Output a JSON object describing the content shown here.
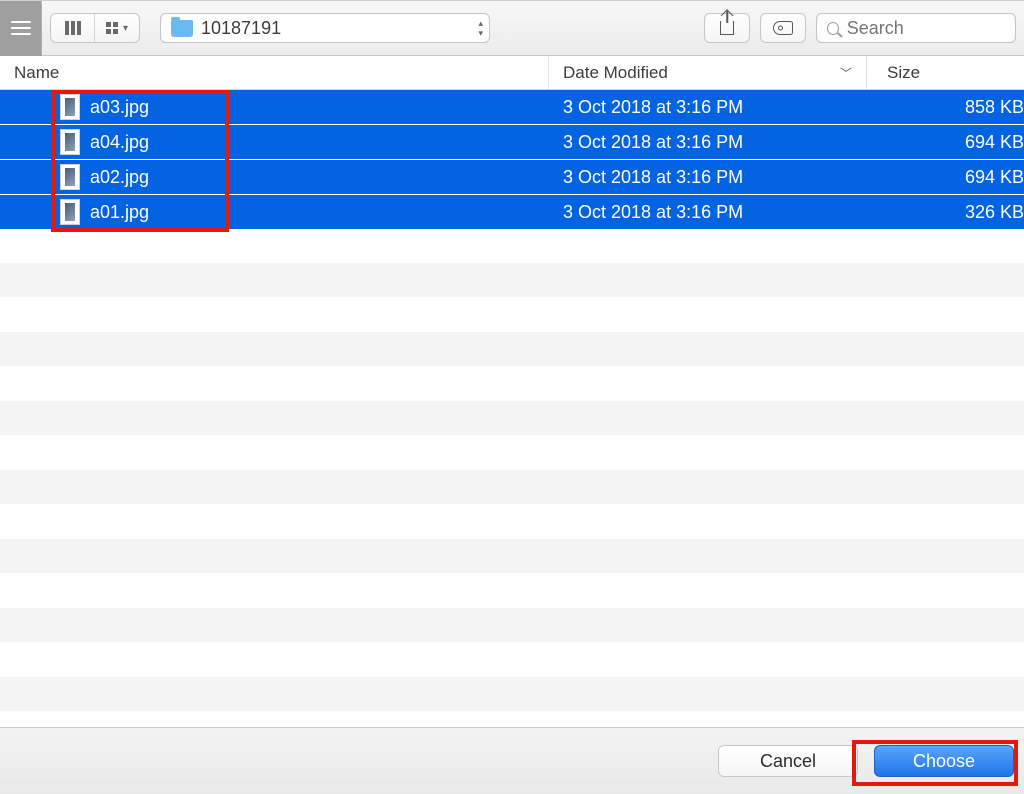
{
  "toolbar": {
    "path_label": "10187191",
    "search_placeholder": "Search"
  },
  "columns": {
    "name": "Name",
    "date": "Date Modified",
    "size": "Size"
  },
  "files": [
    {
      "name": "a03.jpg",
      "date": "3 Oct 2018 at 3:16 PM",
      "size": "858 KB",
      "selected": true
    },
    {
      "name": "a04.jpg",
      "date": "3 Oct 2018 at 3:16 PM",
      "size": "694 KB",
      "selected": true
    },
    {
      "name": "a02.jpg",
      "date": "3 Oct 2018 at 3:16 PM",
      "size": "694 KB",
      "selected": true
    },
    {
      "name": "a01.jpg",
      "date": "3 Oct 2018 at 3:16 PM",
      "size": "326 KB",
      "selected": true
    }
  ],
  "footer": {
    "cancel": "Cancel",
    "choose": "Choose"
  }
}
